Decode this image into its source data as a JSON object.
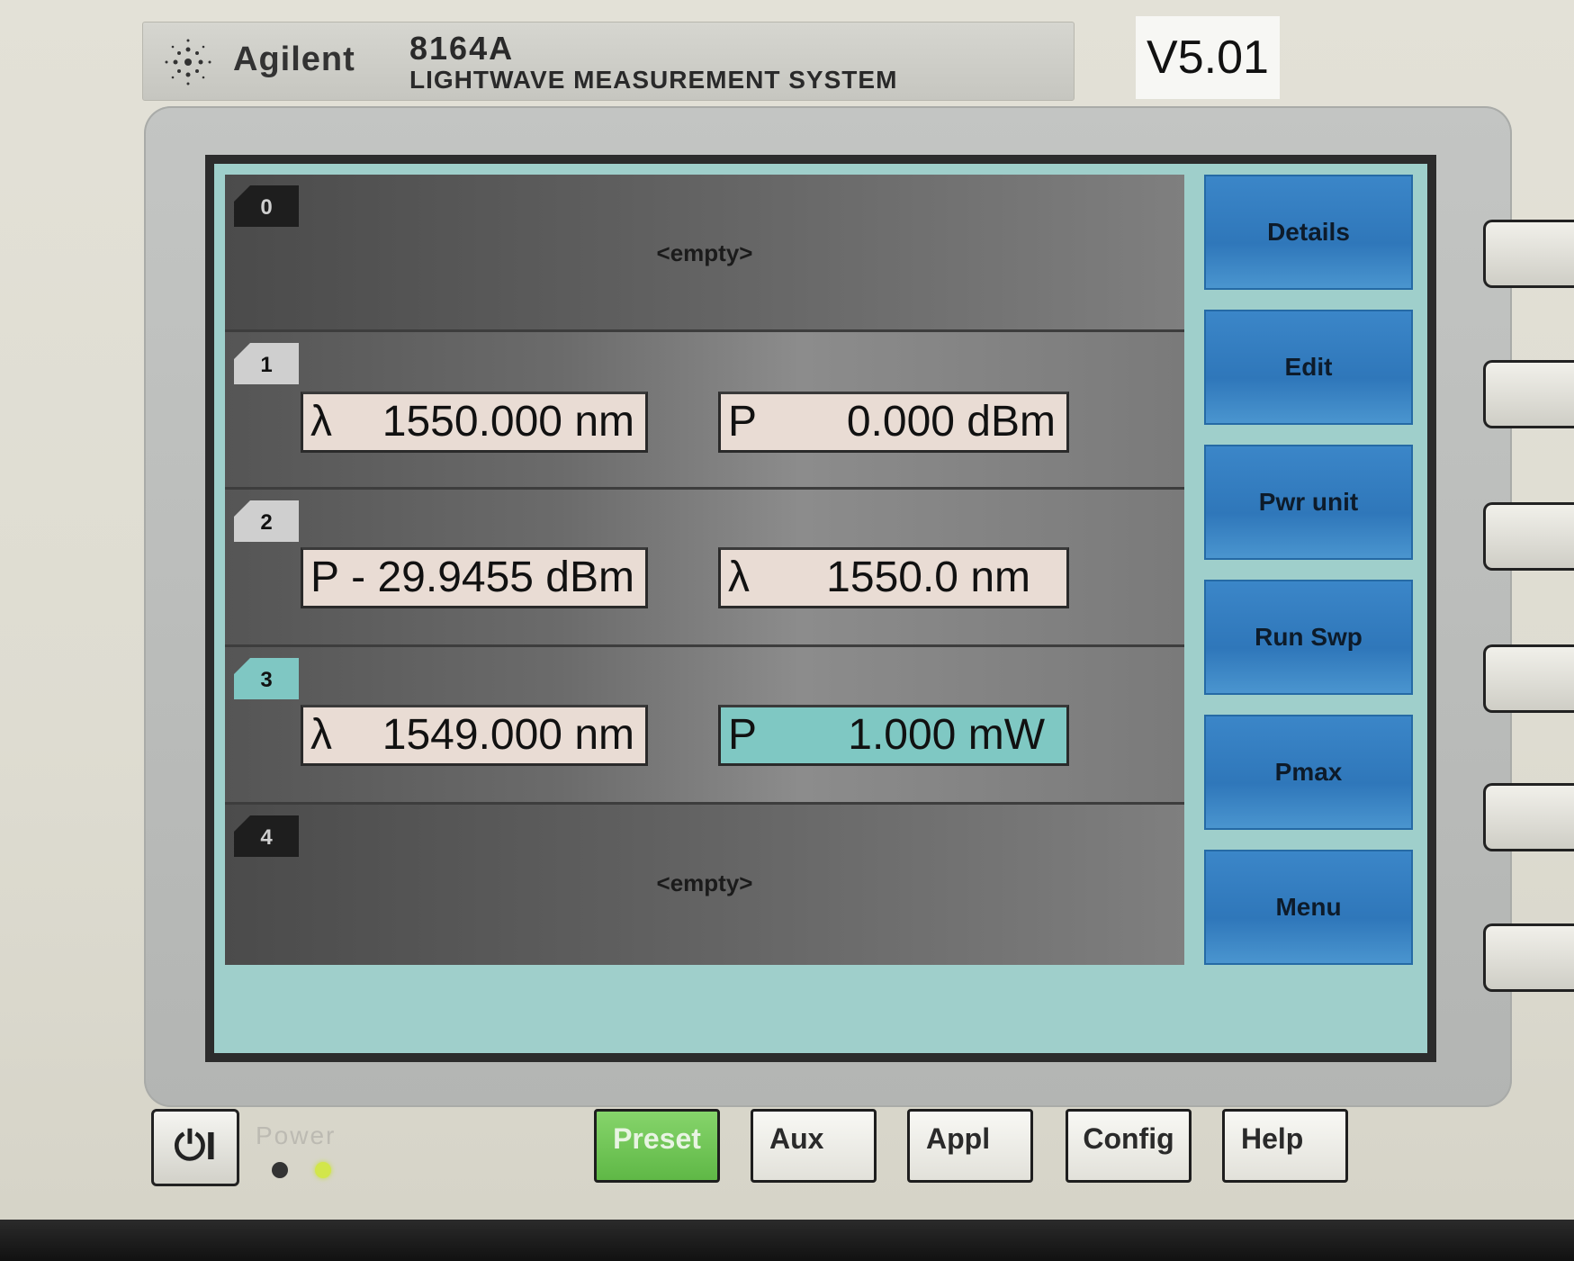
{
  "header": {
    "brand": "Agilent",
    "model": "8164A",
    "description": "LIGHTWAVE MEASUREMENT SYSTEM",
    "version": "V5.01"
  },
  "slots": [
    {
      "number": "0",
      "empty_text": "<empty>"
    },
    {
      "number": "1",
      "left": {
        "symbol": "λ",
        "value": "1550.000 nm"
      },
      "right": {
        "symbol": "P",
        "value": "0.000 dBm"
      }
    },
    {
      "number": "2",
      "left": {
        "symbol": "P",
        "value": "- 29.9455 dBm"
      },
      "right": {
        "symbol": "λ",
        "value": "1550.0 nm"
      }
    },
    {
      "number": "3",
      "left": {
        "symbol": "λ",
        "value": "1549.000 nm"
      },
      "right": {
        "symbol": "P",
        "value": "1.000 mW"
      }
    },
    {
      "number": "4",
      "empty_text": "<empty>"
    }
  ],
  "softkeys": [
    "Details",
    "Edit",
    "Pwr unit",
    "Run Swp",
    "Pmax",
    "Menu"
  ],
  "front_panel": {
    "power_symbol": "⏻I",
    "power_label": "Power",
    "buttons": [
      "Preset",
      "Aux",
      "Appl",
      "Config",
      "Help"
    ]
  },
  "colors": {
    "screen_accent": "#9fcfcb",
    "softkey_blue": "#2f77ba",
    "preset_green": "#5fb846"
  }
}
